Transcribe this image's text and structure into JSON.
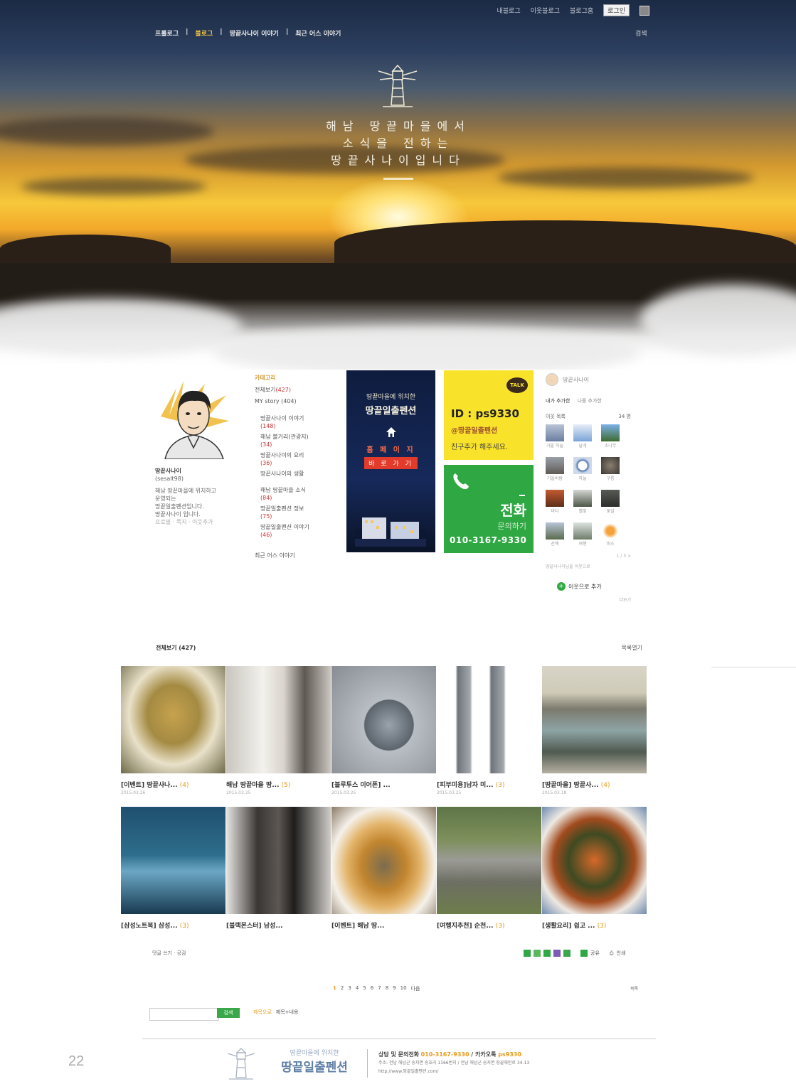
{
  "topbar": {
    "links": [
      "내블로그",
      "이웃블로그",
      "블로그홈"
    ],
    "login": "로그인"
  },
  "nav": {
    "items": [
      "프롤로그",
      "블로그",
      "땅끝사나이 이야기",
      "최근 어스 이야기"
    ],
    "active_index": 1,
    "search": "검색"
  },
  "hero": {
    "slogan_lines": [
      "해남 땅끝마을에서",
      "소식을 전하는",
      "땅끝사나이입니다"
    ]
  },
  "profile": {
    "name": "땅끝사나이",
    "id": "(sesalt98)",
    "desc_lines": [
      "해남 땅끝마을에 위치하고",
      "운영되는",
      "땅끝일출펜션입니다.",
      "땅끝사나이 입니다."
    ],
    "links": "프로필 · 쪽지 · 이웃추가"
  },
  "categories": {
    "header": "카테고리",
    "all": "전체보기",
    "all_count": "(427)",
    "first": "MY story (404)",
    "items": [
      {
        "label": "땅끝사나이 이야기",
        "count": "(148)"
      },
      {
        "label": "해남 볼거리(관광지)",
        "count": "(34)"
      },
      {
        "label": "땅끝사나이의 요리",
        "count": "(36)"
      },
      {
        "label": "땅끝사나이의 생활",
        "count": ""
      },
      {
        "label": "해남 땅끝마을 소식",
        "count": "(84)"
      },
      {
        "label": "땅끝일출펜션 정보",
        "count": "(75)"
      },
      {
        "label": "땅끝일출펜션 이야기",
        "count": "(46)"
      }
    ],
    "last": "최근 어스 이야기"
  },
  "banner_blue": {
    "line1": "땅끝마을에 위치한",
    "line2": "땅끝일출펜션",
    "line3": "홈 페 이 지",
    "button": "바 로 가 기"
  },
  "banner_yellow": {
    "talk": "TALK",
    "id": "ID : ps9330",
    "at": "@땅끝일출펜션",
    "friend": "친구추가 해주세요."
  },
  "banner_green": {
    "call": "전화",
    "ask": "문의하기",
    "number": "010-3167-9330"
  },
  "neighbors": {
    "me": "땅끝사나이",
    "tabs": [
      "내가 추가한",
      "나를 추가한"
    ],
    "sub_left": "이웃 목록",
    "sub_right": "34 명",
    "names": [
      "가을 하늘",
      "날개",
      "소나무",
      "가을바람",
      "하늘",
      "구름",
      "바다",
      "별빛",
      "꽃길",
      "산책",
      "여행",
      "미소"
    ],
    "pager": "1 / 3 >",
    "note": "땅끝사나이님을 이웃으로",
    "add": "이웃으로 추가",
    "more": "더보기"
  },
  "posts_header": {
    "all": "전체보기 (427)",
    "list": "목록열기"
  },
  "posts": [
    {
      "title": "[이벤트] 땅끝사나...",
      "count": "(4)",
      "date": "2015.03.26"
    },
    {
      "title": "해남 땅끝마을 땅...",
      "count": "(5)",
      "date": "2015.03.25"
    },
    {
      "title": "[블루투스 이어폰] ...",
      "count": "",
      "date": "2015.03.25"
    },
    {
      "title": "[피부미용]남자 미...",
      "count": "(3)",
      "date": "2015.03.25"
    },
    {
      "title": "[땅끝마을] 땅끝사...",
      "count": "(4)",
      "date": "2015.03.18"
    },
    {
      "title": "[삼성노트북] 삼성...",
      "count": "(3)",
      "date": ""
    },
    {
      "title": "[블랙몬스터] 남성...",
      "count": "",
      "date": ""
    },
    {
      "title": "[이벤트] 해남 땅...",
      "count": "",
      "date": ""
    },
    {
      "title": "[여행지추천] 순천...",
      "count": "(3)",
      "date": ""
    },
    {
      "title": "[생활요리] 쉽고 ...",
      "count": "(3)",
      "date": ""
    }
  ],
  "under_grid": {
    "left": "댓글 쓰기 · 공감",
    "share": "공유",
    "print": "인쇄"
  },
  "pager": {
    "pages": [
      "1",
      "2",
      "3",
      "4",
      "5",
      "6",
      "7",
      "8",
      "9",
      "10"
    ],
    "next": "다음",
    "current": "1",
    "listall": "목록"
  },
  "search": {
    "button": "검색",
    "opt1": "제목으로",
    "opt2": "제목+내용"
  },
  "footer": {
    "name_top": "땅끝마을에 위치한",
    "name_main": "땅끝일출펜션",
    "contact_lead": "상담 및 문의전화",
    "phone": "010-3167-9330",
    "kakao_lead": " / 카카오톡 ",
    "kakao": "ps9330",
    "address": "주소: 전남 해남군 송지면 송호리 1166번지 / 전남 해남군 송지면 땅끝해안로 34-13",
    "url": "http://www.땅끝일출펜션.com/"
  },
  "page_number": "22",
  "colors": {
    "accent_green": "#2fa843",
    "accent_yellow": "#f8e22a",
    "accent_orange": "#e89a1a",
    "banner_navy": "#16295a"
  }
}
